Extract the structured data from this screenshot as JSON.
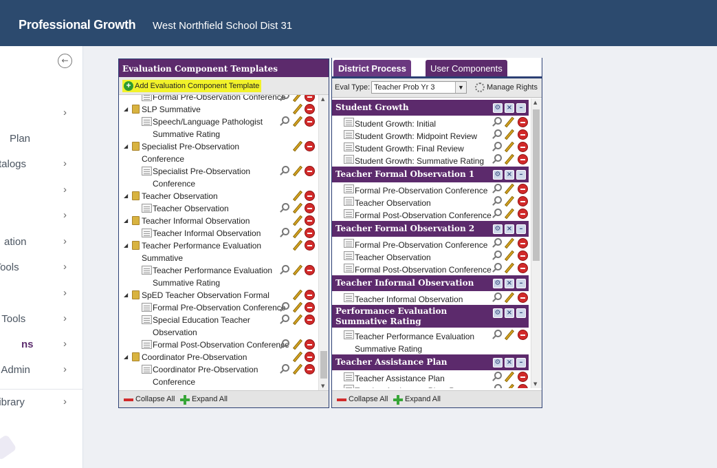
{
  "header": {
    "app_title": "Professional Growth",
    "district": "West Northfield School Dist 31"
  },
  "sidebar": {
    "items": [
      {
        "label": ""
      },
      {
        "label": "Plan"
      },
      {
        "label": "talogs"
      },
      {
        "label": ""
      },
      {
        "label": ""
      },
      {
        "label": "ation"
      },
      {
        "label": "ction Tools"
      },
      {
        "label": ""
      },
      {
        "label": "n Tools"
      },
      {
        "label": "ns"
      },
      {
        "label": "Sys Admin"
      },
      {
        "label": "Library"
      }
    ]
  },
  "templates_panel": {
    "title": "Evaluation Component Templates",
    "add_button": "Add Evaluation Component Template",
    "tree": [
      {
        "label": "Formal Pre-Observation Conference",
        "level": 1
      },
      {
        "label": "SLP Summative",
        "level": 0
      },
      {
        "label": "Speech/Language Pathologist",
        "label2": "Summative Rating",
        "level": 1
      },
      {
        "label": "Specialist Pre-Observation",
        "label2": "Conference",
        "level": 0
      },
      {
        "label": "Specialist Pre-Observation",
        "label2": "Conference",
        "level": 1
      },
      {
        "label": "Teacher Observation",
        "level": 0
      },
      {
        "label": "Teacher Observation",
        "level": 1
      },
      {
        "label": "Teacher Informal Observation",
        "level": 0
      },
      {
        "label": "Teacher Informal Observation",
        "level": 1
      },
      {
        "label": "Teacher Performance Evaluation",
        "label2": "Summative",
        "level": 0
      },
      {
        "label": "Teacher Performance Evaluation",
        "label2": "Summative Rating",
        "level": 1
      },
      {
        "label": "SpED Teacher Observation Formal",
        "level": 0
      },
      {
        "label": "Formal Pre-Observation Conference",
        "level": 1
      },
      {
        "label": "Special Education Teacher",
        "label2": "Observation",
        "level": 1
      },
      {
        "label": "Formal Post-Observation Conference",
        "level": 1
      },
      {
        "label": "Coordinator Pre-Observation",
        "level": 0
      },
      {
        "label": "Coordinator Pre-Observation",
        "label2": "Conference",
        "level": 1
      }
    ],
    "collapse_all": "Collapse All",
    "expand_all": "Expand All"
  },
  "process_panel": {
    "tabs": [
      {
        "label": "District Process",
        "active": true
      },
      {
        "label": "User Components",
        "active": false
      }
    ],
    "eval_type_label": "Eval Type:",
    "eval_type_value": "Teacher Prob Yr 3",
    "manage_rights": "Manage Rights",
    "sections": [
      {
        "title": "Student Growth",
        "items": [
          "Student Growth: Initial",
          "Student Growth: Midpoint Review",
          "Student Growth: Final Review",
          "Student Growth: Summative Rating"
        ]
      },
      {
        "title": "Teacher Formal Observation 1",
        "items": [
          "Formal Pre-Observation Conference",
          "Teacher Observation",
          "Formal Post-Observation Conference"
        ]
      },
      {
        "title": "Teacher Formal Observation 2",
        "items": [
          "Formal Pre-Observation Conference",
          "Teacher Observation",
          "Formal Post-Observation Conference"
        ]
      },
      {
        "title": "Teacher Informal Observation",
        "items": [
          "Teacher Informal Observation"
        ]
      },
      {
        "title": "Performance Evaluation Summative Rating",
        "items": [
          "Teacher Performance Evaluation Summative Rating"
        ]
      },
      {
        "title": "Teacher Assistance Plan",
        "items": [
          "Teacher Assistance Plan",
          "Teacher Assistance Plan: Progress"
        ]
      }
    ],
    "collapse_all": "Collapse All",
    "expand_all": "Expand All"
  }
}
